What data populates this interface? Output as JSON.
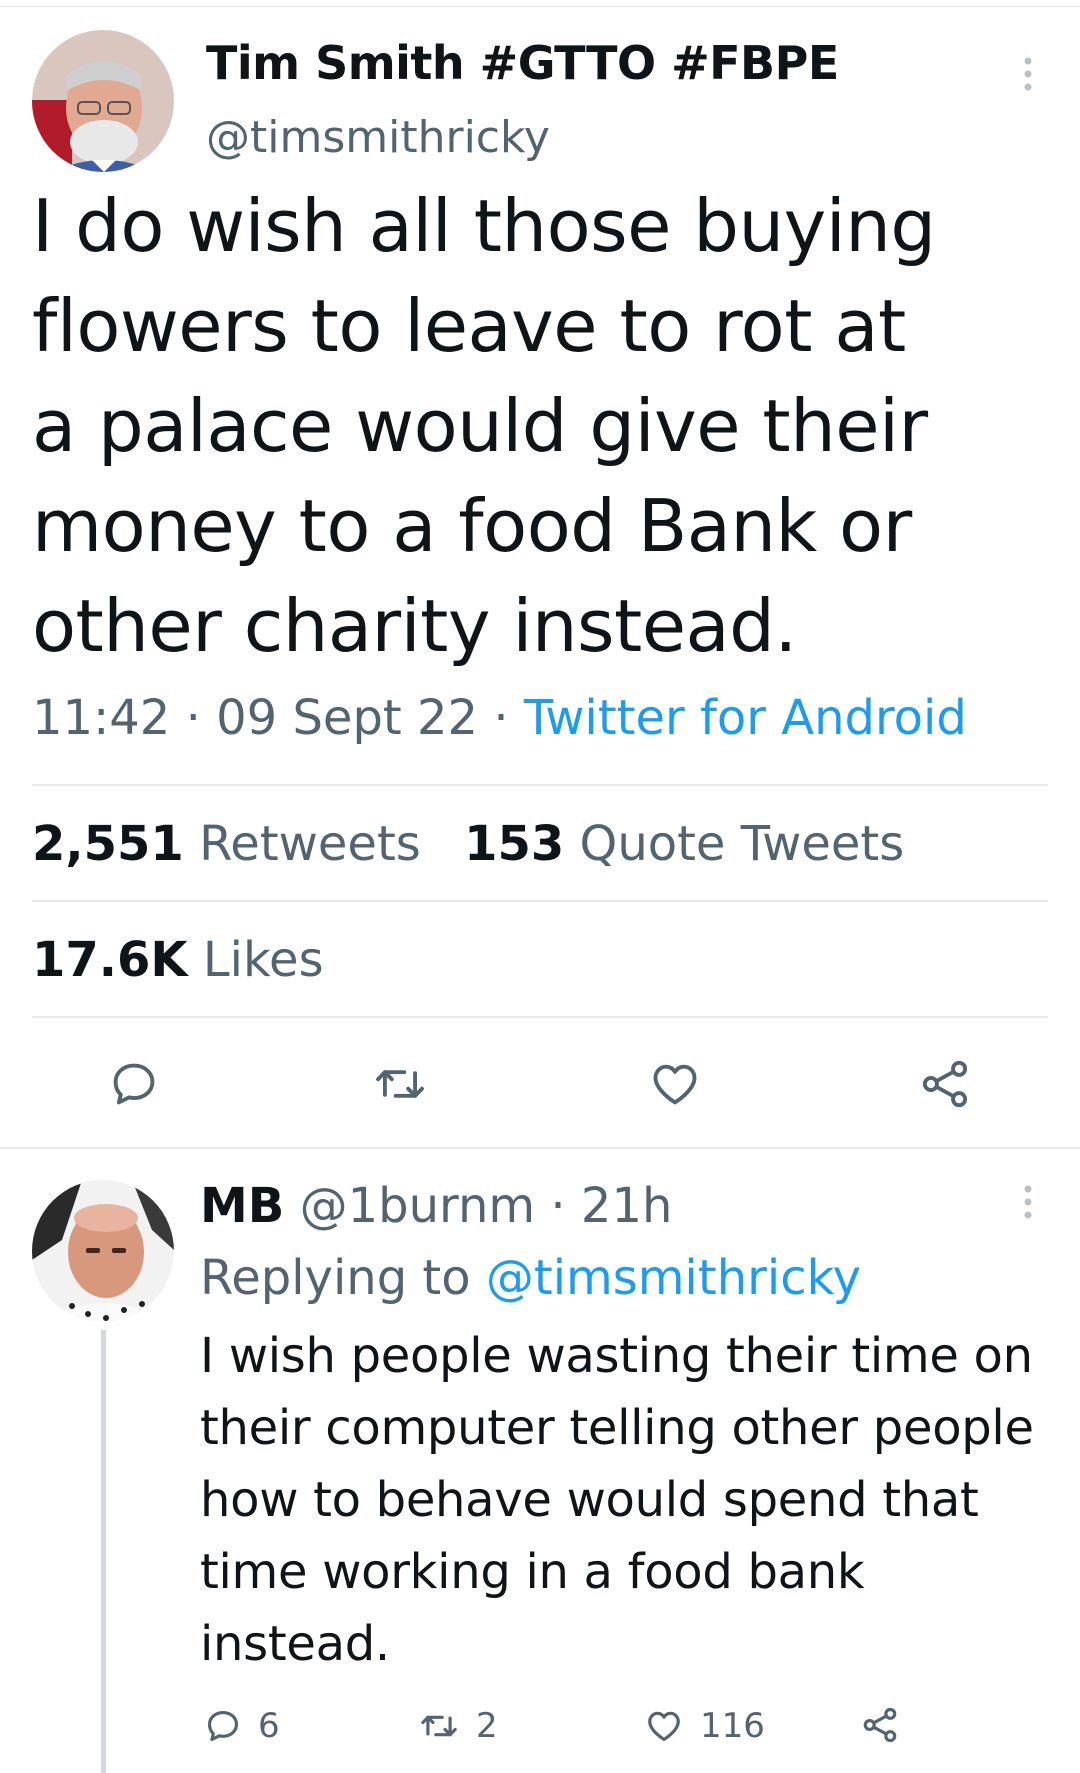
{
  "tweet": {
    "author_name": "Tim Smith #GTTO #FBPE",
    "author_handle": "@timsmithricky",
    "text_lines": [
      "I do wish all those buying",
      "flowers to leave to rot at",
      "a palace would give their",
      "money to a food Bank or",
      "other charity instead."
    ],
    "time": "11:42",
    "date": "09 Sept 22",
    "source": "Twitter for Android",
    "retweets_count": "2,551",
    "retweets_label": "Retweets",
    "quotes_count": "153",
    "quotes_label": "Quote Tweets",
    "likes_count": "17.6K",
    "likes_label": "Likes",
    "actions": [
      "reply-icon",
      "retweet-icon",
      "like-icon",
      "share-icon"
    ],
    "more_icon": "more-vertical-icon"
  },
  "reply": {
    "author_name": "MB",
    "author_handle": "@1burnm",
    "age": "21h",
    "replying_label": "Replying to",
    "replying_to": "@timsmithricky",
    "text_lines": [
      "I wish people wasting their time on",
      "their computer telling other people",
      "how to behave would spend that",
      "time working in a food bank",
      "instead."
    ],
    "reply_count": "6",
    "retweet_count": "2",
    "like_count": "116"
  },
  "colors": {
    "accent": "#1d9bf0",
    "text": "#0f1419",
    "muted": "#536471",
    "divider": "#e7e9ea"
  }
}
